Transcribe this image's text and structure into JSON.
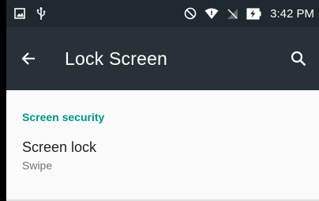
{
  "status_bar": {
    "time": "3:42 PM",
    "icons": [
      "image-icon",
      "usb-icon",
      "do-not-disturb-icon",
      "wifi-icon",
      "no-signal-icon",
      "battery-charging-icon"
    ],
    "background": "#1e2a30"
  },
  "toolbar": {
    "title": "Lock Screen",
    "back_icon": "arrow-back-icon",
    "search_icon": "search-icon",
    "background": "#263238"
  },
  "settings": {
    "section_header": "Screen security",
    "accent": "#009688",
    "items": [
      {
        "title": "Screen lock",
        "summary": "Swipe"
      }
    ]
  }
}
